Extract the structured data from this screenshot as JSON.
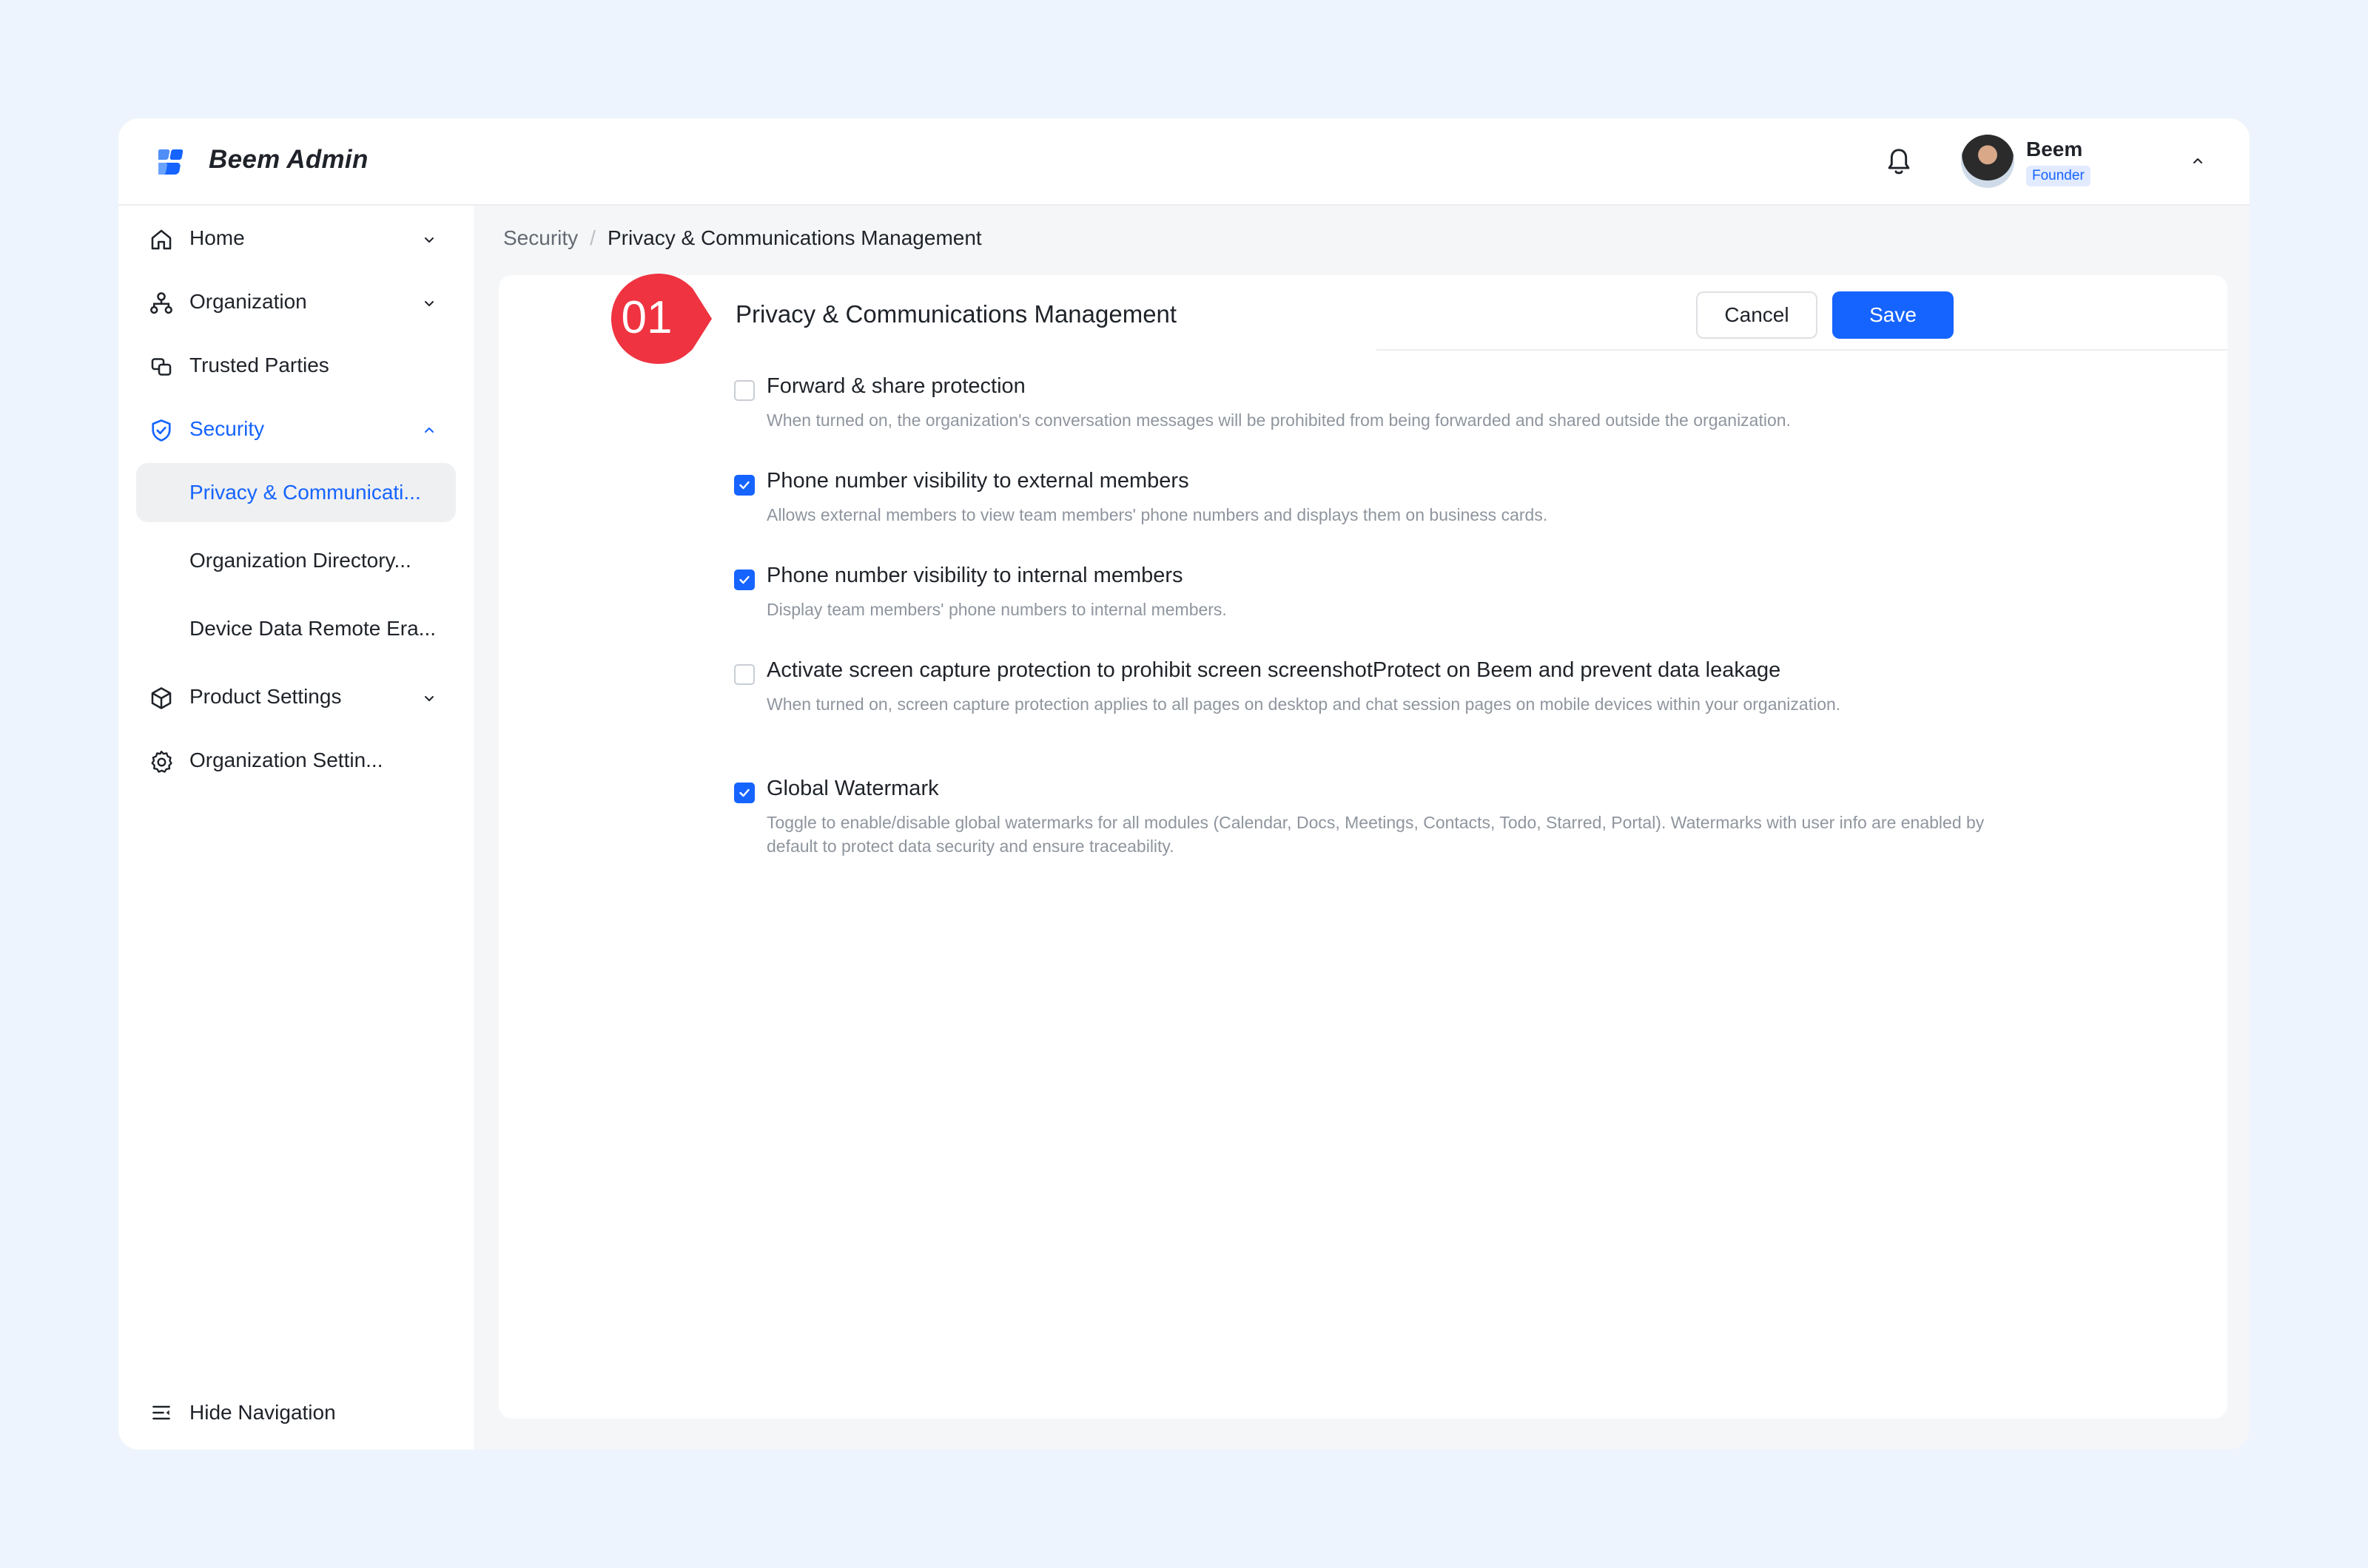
{
  "app": {
    "title": "Beem Admin",
    "brand_color": "#1664ff"
  },
  "header": {
    "bell_icon": "bell-icon",
    "user": {
      "name": "Beem",
      "role": "Founder"
    },
    "menu_icon": "chevron-up-icon"
  },
  "sidebar": {
    "items": [
      {
        "label": "Home",
        "icon": "home-icon",
        "arrow": "chevron-down-icon"
      },
      {
        "label": "Organization",
        "icon": "org-tree-icon",
        "arrow": "chevron-down-icon"
      },
      {
        "label": "Trusted Parties",
        "icon": "trusted-parties-icon"
      },
      {
        "label": "Security",
        "icon": "shield-icon",
        "arrow": "chevron-up-icon"
      },
      {
        "label": "Product Settings",
        "icon": "cube-icon",
        "arrow": "chevron-down-icon"
      },
      {
        "label": "Organization Settin...",
        "icon": "gear-icon"
      }
    ],
    "security_sub": [
      {
        "label": "Privacy & Communicati..."
      },
      {
        "label": "Organization Directory..."
      },
      {
        "label": "Device Data Remote Era..."
      }
    ],
    "hide_nav": "Hide Navigation"
  },
  "breadcrumb": {
    "parent": "Security",
    "separator": "/",
    "current": "Privacy & Communications Management"
  },
  "panel": {
    "step": "01",
    "title": "Privacy & Communications Management",
    "cancel": "Cancel",
    "save": "Save",
    "options": [
      {
        "label": "Forward & share protection",
        "checked": false,
        "desc": "When turned on, the organization's conversation messages will be prohibited from being forwarded and shared outside the organization."
      },
      {
        "label": "Phone number visibility to external members",
        "checked": true,
        "desc": "Allows external members to view team members' phone numbers and displays them on business cards."
      },
      {
        "label": "Phone number visibility to internal members",
        "checked": true,
        "desc": "Display team members' phone numbers to internal members."
      },
      {
        "label": "Activate screen capture protection to prohibit screen screenshotProtect on Beem and prevent data leakage",
        "checked": false,
        "desc": "When turned on, screen capture protection applies to all pages on desktop and chat session pages on mobile devices within your organization."
      },
      {
        "label": "Global Watermark",
        "checked": true,
        "desc": "Toggle to enable/disable global watermarks for all modules (Calendar, Docs, Meetings, Contacts, Todo, Starred, Portal). Watermarks with user info are enabled by default to protect data security and ensure traceability."
      }
    ]
  }
}
